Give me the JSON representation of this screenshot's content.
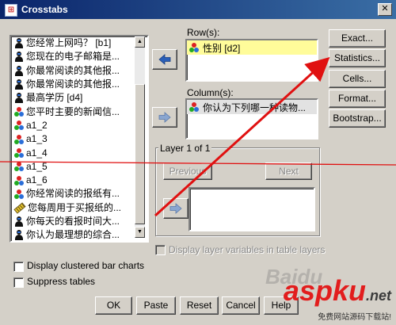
{
  "window": {
    "title": "Crosstabs",
    "close_glyph": "✕"
  },
  "variables": [
    {
      "label": "您经常上网吗？ [b1]",
      "icon": "person"
    },
    {
      "label": "您现在的电子邮箱是...",
      "icon": "person"
    },
    {
      "label": "你最常阅读的其他报...",
      "icon": "person"
    },
    {
      "label": "你最常阅读的其他报...",
      "icon": "person"
    },
    {
      "label": "最高学历 [d4]",
      "icon": "person"
    },
    {
      "label": "您平时主要的新闻信...",
      "icon": "nominal"
    },
    {
      "label": "a1_2",
      "icon": "nominal"
    },
    {
      "label": "a1_3",
      "icon": "nominal"
    },
    {
      "label": "a1_4",
      "icon": "nominal"
    },
    {
      "label": "a1_5",
      "icon": "nominal"
    },
    {
      "label": "a1_6",
      "icon": "nominal"
    },
    {
      "label": "你经常阅读的报纸有...",
      "icon": "nominal"
    },
    {
      "label": "您每周用于买报纸的...",
      "icon": "scale"
    },
    {
      "label": "你每天的看报时间大...",
      "icon": "person"
    },
    {
      "label": "你认为最理想的综合...",
      "icon": "person"
    }
  ],
  "rows": {
    "label": "Row(s):",
    "items": [
      {
        "label": "性别 [d2]",
        "icon": "nominal"
      }
    ]
  },
  "columns": {
    "label": "Column(s):",
    "items": [
      {
        "label": "你认为下列哪一种读物...",
        "icon": "nominal"
      }
    ]
  },
  "layer": {
    "title": "Layer 1 of 1",
    "previous": "Previous",
    "next": "Next",
    "display_layer_vars": "Display layer variables in table layers"
  },
  "side_buttons": [
    "Exact...",
    "Statistics...",
    "Cells...",
    "Format...",
    "Bootstrap..."
  ],
  "options": {
    "clustered": "Display clustered bar charts",
    "suppress": "Suppress tables"
  },
  "bottom_buttons": [
    "OK",
    "Paste",
    "Reset",
    "Cancel",
    "Help"
  ],
  "watermark": {
    "brand_a": "asp",
    "brand_b": "ku",
    "brand_c": ".net",
    "subtitle": "免费网站源码下载站!",
    "baidu": "Baidu"
  },
  "colors": {
    "title_start": "#0a246a",
    "title_end": "#3a6ea5",
    "annotation": "#e01010",
    "selected_bg": "#fffc9a"
  }
}
